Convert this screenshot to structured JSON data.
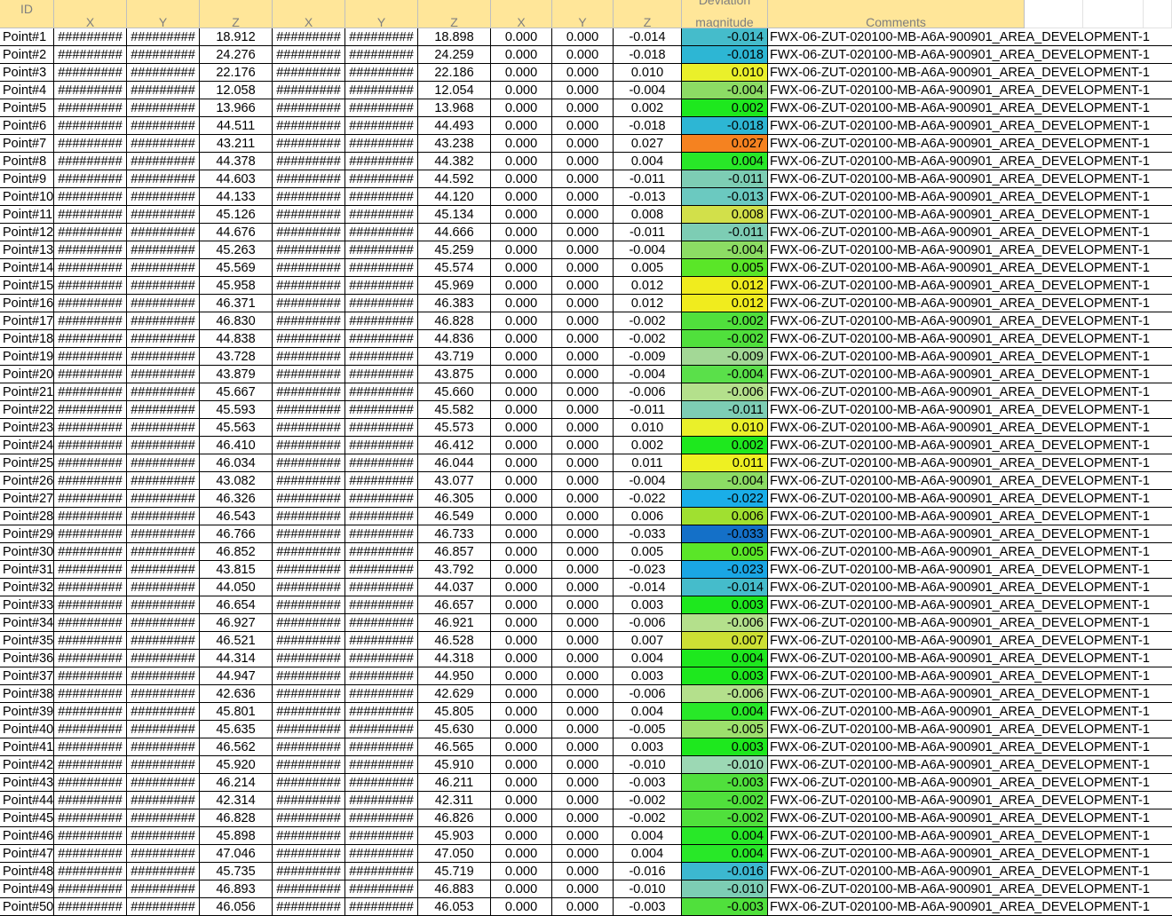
{
  "headers": {
    "id": "ID",
    "x1": "X",
    "y1": "Y",
    "z1": "Z",
    "x2": "X",
    "y2": "Y",
    "z2": "Z",
    "dx": "X",
    "dy": "Y",
    "dz": "Z",
    "dev_line1": "Deviation",
    "dev_line2": "magnitude",
    "comments": "Comments"
  },
  "overflow_text": "#########",
  "colors": {
    "header_fill": "#ffe699",
    "header_text": "#7f7f7f"
  },
  "rows": [
    {
      "id": "Point#1",
      "z1": "18.912",
      "z2": "18.898",
      "dx": "0.000",
      "dy": "0.000",
      "dz": "-0.014",
      "dev": "-0.014",
      "color": "#45bccb",
      "comment": "FWX-06-ZUT-020100-MB-A6A-900901_AREA_DEVELOPMENT-1"
    },
    {
      "id": "Point#2",
      "z1": "24.276",
      "z2": "24.259",
      "dx": "0.000",
      "dy": "0.000",
      "dz": "-0.018",
      "dev": "-0.018",
      "color": "#2db6d4",
      "comment": "FWX-06-ZUT-020100-MB-A6A-900901_AREA_DEVELOPMENT-1"
    },
    {
      "id": "Point#3",
      "z1": "22.176",
      "z2": "22.186",
      "dx": "0.000",
      "dy": "0.000",
      "dz": "0.010",
      "dev": "0.010",
      "color": "#eaf02a",
      "comment": "FWX-06-ZUT-020100-MB-A6A-900901_AREA_DEVELOPMENT-1"
    },
    {
      "id": "Point#4",
      "z1": "12.058",
      "z2": "12.054",
      "dx": "0.000",
      "dy": "0.000",
      "dz": "-0.004",
      "dev": "-0.004",
      "color": "#8cdc64",
      "comment": "FWX-06-ZUT-020100-MB-A6A-900901_AREA_DEVELOPMENT-1"
    },
    {
      "id": "Point#5",
      "z1": "13.966",
      "z2": "13.968",
      "dx": "0.000",
      "dy": "0.000",
      "dz": "0.002",
      "dev": "0.002",
      "color": "#1ee81e",
      "comment": "FWX-06-ZUT-020100-MB-A6A-900901_AREA_DEVELOPMENT-1"
    },
    {
      "id": "Point#6",
      "z1": "44.511",
      "z2": "44.493",
      "dx": "0.000",
      "dy": "0.000",
      "dz": "-0.018",
      "dev": "-0.018",
      "color": "#2db6d4",
      "comment": "FWX-06-ZUT-020100-MB-A6A-900901_AREA_DEVELOPMENT-1"
    },
    {
      "id": "Point#7",
      "z1": "43.211",
      "z2": "43.238",
      "dx": "0.000",
      "dy": "0.000",
      "dz": "0.027",
      "dev": "0.027",
      "color": "#f58220",
      "comment": "FWX-06-ZUT-020100-MB-A6A-900901_AREA_DEVELOPMENT-1"
    },
    {
      "id": "Point#8",
      "z1": "44.378",
      "z2": "44.382",
      "dx": "0.000",
      "dy": "0.000",
      "dz": "0.004",
      "dev": "0.004",
      "color": "#28e828",
      "comment": "FWX-06-ZUT-020100-MB-A6A-900901_AREA_DEVELOPMENT-1"
    },
    {
      "id": "Point#9",
      "z1": "44.603",
      "z2": "44.592",
      "dx": "0.000",
      "dy": "0.000",
      "dz": "-0.011",
      "dev": "-0.011",
      "color": "#7dcdb4",
      "comment": "FWX-06-ZUT-020100-MB-A6A-900901_AREA_DEVELOPMENT-1"
    },
    {
      "id": "Point#10",
      "z1": "44.133",
      "z2": "44.120",
      "dx": "0.000",
      "dy": "0.000",
      "dz": "-0.013",
      "dev": "-0.013",
      "color": "#6bc9c0",
      "comment": "FWX-06-ZUT-020100-MB-A6A-900901_AREA_DEVELOPMENT-1"
    },
    {
      "id": "Point#11",
      "z1": "45.126",
      "z2": "45.134",
      "dx": "0.000",
      "dy": "0.000",
      "dz": "0.008",
      "dev": "0.008",
      "color": "#d2e04a",
      "comment": "FWX-06-ZUT-020100-MB-A6A-900901_AREA_DEVELOPMENT-1"
    },
    {
      "id": "Point#12",
      "z1": "44.676",
      "z2": "44.666",
      "dx": "0.000",
      "dy": "0.000",
      "dz": "-0.011",
      "dev": "-0.011",
      "color": "#7dcdb4",
      "comment": "FWX-06-ZUT-020100-MB-A6A-900901_AREA_DEVELOPMENT-1"
    },
    {
      "id": "Point#13",
      "z1": "45.263",
      "z2": "45.259",
      "dx": "0.000",
      "dy": "0.000",
      "dz": "-0.004",
      "dev": "-0.004",
      "color": "#8cdc64",
      "comment": "FWX-06-ZUT-020100-MB-A6A-900901_AREA_DEVELOPMENT-1"
    },
    {
      "id": "Point#14",
      "z1": "45.569",
      "z2": "45.574",
      "dx": "0.000",
      "dy": "0.000",
      "dz": "0.005",
      "dev": "0.005",
      "color": "#5ae628",
      "comment": "FWX-06-ZUT-020100-MB-A6A-900901_AREA_DEVELOPMENT-1"
    },
    {
      "id": "Point#15",
      "z1": "45.958",
      "z2": "45.969",
      "dx": "0.000",
      "dy": "0.000",
      "dz": "0.012",
      "dev": "0.012",
      "color": "#f0ec1e",
      "comment": "FWX-06-ZUT-020100-MB-A6A-900901_AREA_DEVELOPMENT-1"
    },
    {
      "id": "Point#16",
      "z1": "46.371",
      "z2": "46.383",
      "dx": "0.000",
      "dy": "0.000",
      "dz": "0.012",
      "dev": "0.012",
      "color": "#f0ec1e",
      "comment": "FWX-06-ZUT-020100-MB-A6A-900901_AREA_DEVELOPMENT-1"
    },
    {
      "id": "Point#17",
      "z1": "46.830",
      "z2": "46.828",
      "dx": "0.000",
      "dy": "0.000",
      "dz": "-0.002",
      "dev": "-0.002",
      "color": "#50e03c",
      "comment": "FWX-06-ZUT-020100-MB-A6A-900901_AREA_DEVELOPMENT-1"
    },
    {
      "id": "Point#18",
      "z1": "44.838",
      "z2": "44.836",
      "dx": "0.000",
      "dy": "0.000",
      "dz": "-0.002",
      "dev": "-0.002",
      "color": "#50e03c",
      "comment": "FWX-06-ZUT-020100-MB-A6A-900901_AREA_DEVELOPMENT-1"
    },
    {
      "id": "Point#19",
      "z1": "43.728",
      "z2": "43.719",
      "dx": "0.000",
      "dy": "0.000",
      "dz": "-0.009",
      "dev": "-0.009",
      "color": "#a3d896",
      "comment": "FWX-06-ZUT-020100-MB-A6A-900901_AREA_DEVELOPMENT-1"
    },
    {
      "id": "Point#20",
      "z1": "43.879",
      "z2": "43.875",
      "dx": "0.000",
      "dy": "0.000",
      "dz": "-0.004",
      "dev": "-0.004",
      "color": "#5ae04a",
      "comment": "FWX-06-ZUT-020100-MB-A6A-900901_AREA_DEVELOPMENT-1"
    },
    {
      "id": "Point#21",
      "z1": "45.667",
      "z2": "45.660",
      "dx": "0.000",
      "dy": "0.000",
      "dz": "-0.006",
      "dev": "-0.006",
      "color": "#b4e08c",
      "comment": "FWX-06-ZUT-020100-MB-A6A-900901_AREA_DEVELOPMENT-1"
    },
    {
      "id": "Point#22",
      "z1": "45.593",
      "z2": "45.582",
      "dx": "0.000",
      "dy": "0.000",
      "dz": "-0.011",
      "dev": "-0.011",
      "color": "#7dcdb4",
      "comment": "FWX-06-ZUT-020100-MB-A6A-900901_AREA_DEVELOPMENT-1"
    },
    {
      "id": "Point#23",
      "z1": "45.563",
      "z2": "45.573",
      "dx": "0.000",
      "dy": "0.000",
      "dz": "0.010",
      "dev": "0.010",
      "color": "#eaf02a",
      "comment": "FWX-06-ZUT-020100-MB-A6A-900901_AREA_DEVELOPMENT-1"
    },
    {
      "id": "Point#24",
      "z1": "46.410",
      "z2": "46.412",
      "dx": "0.000",
      "dy": "0.000",
      "dz": "0.002",
      "dev": "0.002",
      "color": "#1ee81e",
      "comment": "FWX-06-ZUT-020100-MB-A6A-900901_AREA_DEVELOPMENT-1"
    },
    {
      "id": "Point#25",
      "z1": "46.034",
      "z2": "46.044",
      "dx": "0.000",
      "dy": "0.000",
      "dz": "0.011",
      "dev": "0.011",
      "color": "#eef022",
      "comment": "FWX-06-ZUT-020100-MB-A6A-900901_AREA_DEVELOPMENT-1"
    },
    {
      "id": "Point#26",
      "z1": "43.082",
      "z2": "43.077",
      "dx": "0.000",
      "dy": "0.000",
      "dz": "-0.004",
      "dev": "-0.004",
      "color": "#8cdc64",
      "comment": "FWX-06-ZUT-020100-MB-A6A-900901_AREA_DEVELOPMENT-1"
    },
    {
      "id": "Point#27",
      "z1": "46.326",
      "z2": "46.305",
      "dx": "0.000",
      "dy": "0.000",
      "dz": "-0.022",
      "dev": "-0.022",
      "color": "#1aaee8",
      "comment": "FWX-06-ZUT-020100-MB-A6A-900901_AREA_DEVELOPMENT-1"
    },
    {
      "id": "Point#28",
      "z1": "46.543",
      "z2": "46.549",
      "dx": "0.000",
      "dy": "0.000",
      "dz": "0.006",
      "dev": "0.006",
      "color": "#a0e030",
      "comment": "FWX-06-ZUT-020100-MB-A6A-900901_AREA_DEVELOPMENT-1"
    },
    {
      "id": "Point#29",
      "z1": "46.766",
      "z2": "46.733",
      "dx": "0.000",
      "dy": "0.000",
      "dz": "-0.033",
      "dev": "-0.033",
      "color": "#1470c8",
      "comment": "FWX-06-ZUT-020100-MB-A6A-900901_AREA_DEVELOPMENT-1"
    },
    {
      "id": "Point#30",
      "z1": "46.852",
      "z2": "46.857",
      "dx": "0.000",
      "dy": "0.000",
      "dz": "0.005",
      "dev": "0.005",
      "color": "#5ae628",
      "comment": "FWX-06-ZUT-020100-MB-A6A-900901_AREA_DEVELOPMENT-1"
    },
    {
      "id": "Point#31",
      "z1": "43.815",
      "z2": "43.792",
      "dx": "0.000",
      "dy": "0.000",
      "dz": "-0.023",
      "dev": "-0.023",
      "color": "#1aa6e4",
      "comment": "FWX-06-ZUT-020100-MB-A6A-900901_AREA_DEVELOPMENT-1"
    },
    {
      "id": "Point#32",
      "z1": "44.050",
      "z2": "44.037",
      "dx": "0.000",
      "dy": "0.000",
      "dz": "-0.014",
      "dev": "-0.014",
      "color": "#45bccb",
      "comment": "FWX-06-ZUT-020100-MB-A6A-900901_AREA_DEVELOPMENT-1"
    },
    {
      "id": "Point#33",
      "z1": "46.654",
      "z2": "46.657",
      "dx": "0.000",
      "dy": "0.000",
      "dz": "0.003",
      "dev": "0.003",
      "color": "#1ee81e",
      "comment": "FWX-06-ZUT-020100-MB-A6A-900901_AREA_DEVELOPMENT-1"
    },
    {
      "id": "Point#34",
      "z1": "46.927",
      "z2": "46.921",
      "dx": "0.000",
      "dy": "0.000",
      "dz": "-0.006",
      "dev": "-0.006",
      "color": "#b4e08c",
      "comment": "FWX-06-ZUT-020100-MB-A6A-900901_AREA_DEVELOPMENT-1"
    },
    {
      "id": "Point#35",
      "z1": "46.521",
      "z2": "46.528",
      "dx": "0.000",
      "dy": "0.000",
      "dz": "0.007",
      "dev": "0.007",
      "color": "#cce034",
      "comment": "FWX-06-ZUT-020100-MB-A6A-900901_AREA_DEVELOPMENT-1"
    },
    {
      "id": "Point#36",
      "z1": "44.314",
      "z2": "44.318",
      "dx": "0.000",
      "dy": "0.000",
      "dz": "0.004",
      "dev": "0.004",
      "color": "#1ee81e",
      "comment": "FWX-06-ZUT-020100-MB-A6A-900901_AREA_DEVELOPMENT-1"
    },
    {
      "id": "Point#37",
      "z1": "44.947",
      "z2": "44.950",
      "dx": "0.000",
      "dy": "0.000",
      "dz": "0.003",
      "dev": "0.003",
      "color": "#1ee81e",
      "comment": "FWX-06-ZUT-020100-MB-A6A-900901_AREA_DEVELOPMENT-1"
    },
    {
      "id": "Point#38",
      "z1": "42.636",
      "z2": "42.629",
      "dx": "0.000",
      "dy": "0.000",
      "dz": "-0.006",
      "dev": "-0.006",
      "color": "#b4e08c",
      "comment": "FWX-06-ZUT-020100-MB-A6A-900901_AREA_DEVELOPMENT-1"
    },
    {
      "id": "Point#39",
      "z1": "45.801",
      "z2": "45.805",
      "dx": "0.000",
      "dy": "0.000",
      "dz": "0.004",
      "dev": "0.004",
      "color": "#28e828",
      "comment": "FWX-06-ZUT-020100-MB-A6A-900901_AREA_DEVELOPMENT-1"
    },
    {
      "id": "Point#40",
      "z1": "45.635",
      "z2": "45.630",
      "dx": "0.000",
      "dy": "0.000",
      "dz": "-0.005",
      "dev": "-0.005",
      "color": "#9ce06c",
      "comment": "FWX-06-ZUT-020100-MB-A6A-900901_AREA_DEVELOPMENT-1"
    },
    {
      "id": "Point#41",
      "z1": "46.562",
      "z2": "46.565",
      "dx": "0.000",
      "dy": "0.000",
      "dz": "0.003",
      "dev": "0.003",
      "color": "#1ee81e",
      "comment": "FWX-06-ZUT-020100-MB-A6A-900901_AREA_DEVELOPMENT-1"
    },
    {
      "id": "Point#42",
      "z1": "45.920",
      "z2": "45.910",
      "dx": "0.000",
      "dy": "0.000",
      "dz": "-0.010",
      "dev": "-0.010",
      "color": "#9cd8b4",
      "comment": "FWX-06-ZUT-020100-MB-A6A-900901_AREA_DEVELOPMENT-1"
    },
    {
      "id": "Point#43",
      "z1": "46.214",
      "z2": "46.211",
      "dx": "0.000",
      "dy": "0.000",
      "dz": "-0.003",
      "dev": "-0.003",
      "color": "#50e03c",
      "comment": "FWX-06-ZUT-020100-MB-A6A-900901_AREA_DEVELOPMENT-1"
    },
    {
      "id": "Point#44",
      "z1": "42.314",
      "z2": "42.311",
      "dx": "0.000",
      "dy": "0.000",
      "dz": "-0.002",
      "dev": "-0.002",
      "color": "#50e03c",
      "comment": "FWX-06-ZUT-020100-MB-A6A-900901_AREA_DEVELOPMENT-1"
    },
    {
      "id": "Point#45",
      "z1": "46.828",
      "z2": "46.826",
      "dx": "0.000",
      "dy": "0.000",
      "dz": "-0.002",
      "dev": "-0.002",
      "color": "#50e03c",
      "comment": "FWX-06-ZUT-020100-MB-A6A-900901_AREA_DEVELOPMENT-1"
    },
    {
      "id": "Point#46",
      "z1": "45.898",
      "z2": "45.903",
      "dx": "0.000",
      "dy": "0.000",
      "dz": "0.004",
      "dev": "0.004",
      "color": "#28e828",
      "comment": "FWX-06-ZUT-020100-MB-A6A-900901_AREA_DEVELOPMENT-1"
    },
    {
      "id": "Point#47",
      "z1": "47.046",
      "z2": "47.050",
      "dx": "0.000",
      "dy": "0.000",
      "dz": "0.004",
      "dev": "0.004",
      "color": "#28e828",
      "comment": "FWX-06-ZUT-020100-MB-A6A-900901_AREA_DEVELOPMENT-1"
    },
    {
      "id": "Point#48",
      "z1": "45.735",
      "z2": "45.719",
      "dx": "0.000",
      "dy": "0.000",
      "dz": "-0.016",
      "dev": "-0.016",
      "color": "#3cb8d0",
      "comment": "FWX-06-ZUT-020100-MB-A6A-900901_AREA_DEVELOPMENT-1"
    },
    {
      "id": "Point#49",
      "z1": "46.893",
      "z2": "46.883",
      "dx": "0.000",
      "dy": "0.000",
      "dz": "-0.010",
      "dev": "-0.010",
      "color": "#7dcdb4",
      "comment": "FWX-06-ZUT-020100-MB-A6A-900901_AREA_DEVELOPMENT-1"
    },
    {
      "id": "Point#50",
      "z1": "46.056",
      "z2": "46.053",
      "dx": "0.000",
      "dy": "0.000",
      "dz": "-0.003",
      "dev": "-0.003",
      "color": "#50e03c",
      "comment": "FWX-06-ZUT-020100-MB-A6A-900901_AREA_DEVELOPMENT-1"
    }
  ]
}
